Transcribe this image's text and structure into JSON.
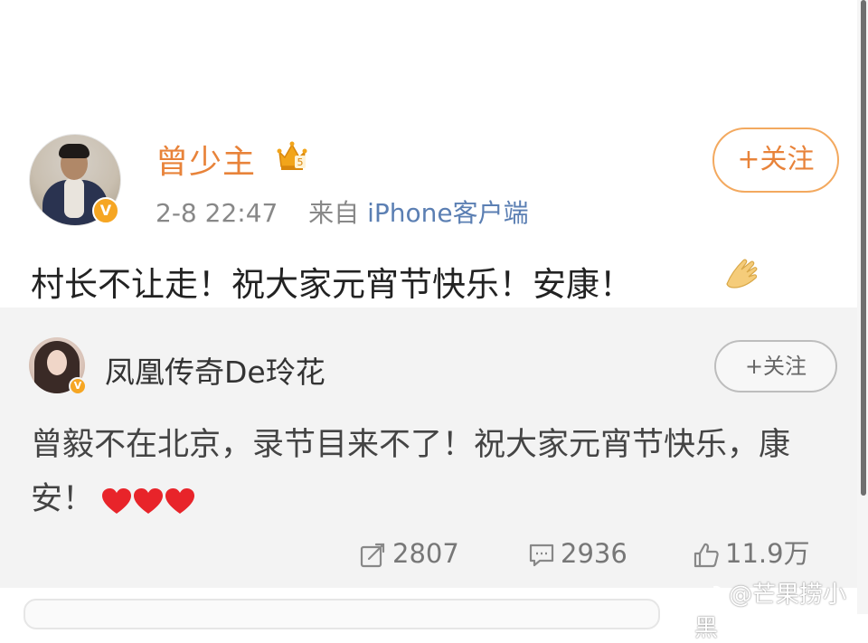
{
  "post": {
    "username": "曾少主",
    "timestamp": "2-8 22:47",
    "source_prefix": "来自",
    "source_app": "iPhone客户端",
    "follow_label": "+关注",
    "text": "村长不让走！祝大家元宵节快乐！安康！",
    "emoji": "clap-hands-icon",
    "verified": true,
    "vip_icon": "crown-badge-icon"
  },
  "repost": {
    "username": "凤凰传奇De玲花",
    "follow_label": "+关注",
    "text": "曾毅不在北京，录节目来不了！祝大家元宵节快乐，康安！",
    "emoji": "heart-icon",
    "emoji_count": 3,
    "verified": true
  },
  "actions": {
    "repost_count": "2807",
    "comment_count": "2936",
    "like_count": "11.9万"
  },
  "watermark": {
    "text": "@芒果捞小黑",
    "icon": "weibo-icon"
  },
  "colors": {
    "username_orange": "#e8833a",
    "source_blue": "#5b7fb3",
    "verified_gold": "#f6a623",
    "heart_red": "#e8242a",
    "repost_background": "#f3f3f3"
  }
}
